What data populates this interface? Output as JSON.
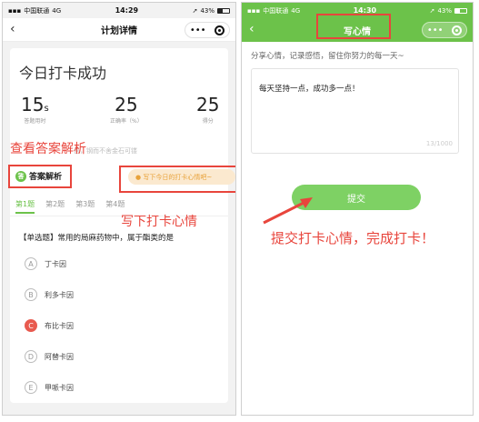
{
  "left_screen": {
    "status": {
      "carrier": "中国联通",
      "network": "4G",
      "time": "14:29",
      "battery": "43%"
    },
    "title": "计划详情",
    "nav_back": "‹",
    "capsule_dots": "•••",
    "success_title": "今日打卡成功",
    "stats": [
      {
        "value": "15",
        "unit": "s",
        "label": "答题用时"
      },
      {
        "value": "25",
        "unit": "",
        "label": "正确率（%）"
      },
      {
        "value": "25",
        "unit": "",
        "label": "得分"
      }
    ],
    "hint": "吾，钢而不舍金石可镂",
    "answer_tag": "答案解析",
    "answer_icon": "答",
    "mood_pill": "● 写下今日的打卡心情吧~",
    "tabs": [
      "第1题",
      "第2题",
      "第3题",
      "第4题"
    ],
    "question": "【单选题】常用的局麻药物中，属于酯类的是",
    "options": [
      {
        "letter": "A",
        "text": "丁卡因"
      },
      {
        "letter": "B",
        "text": "利多卡因"
      },
      {
        "letter": "C",
        "text": "布比卡因"
      },
      {
        "letter": "D",
        "text": "阿替卡因"
      },
      {
        "letter": "E",
        "text": "甲哌卡因"
      }
    ],
    "selected_option": "C",
    "annotations": {
      "answer": "查看答案解析",
      "mood": "写下打卡心情"
    }
  },
  "right_screen": {
    "status": {
      "carrier": "中国联通",
      "network": "4G",
      "time": "14:30",
      "battery": "43%"
    },
    "title": "写心情",
    "nav_back": "‹",
    "capsule_dots": "•••",
    "share_hint": "分享心情，记录感悟，留住你努力的每一天~",
    "mood_text": "每天坚持一点，成功多一点！",
    "char_count": "13/1000",
    "submit_label": "提交",
    "annotation": "提交打卡心情，完成打卡！"
  },
  "colors": {
    "accent_green": "#6cc24a",
    "annotation_red": "#e8453c",
    "selected_red": "#e85a4f",
    "pill_bg": "#fbe9cf",
    "pill_text": "#e8a23a"
  }
}
